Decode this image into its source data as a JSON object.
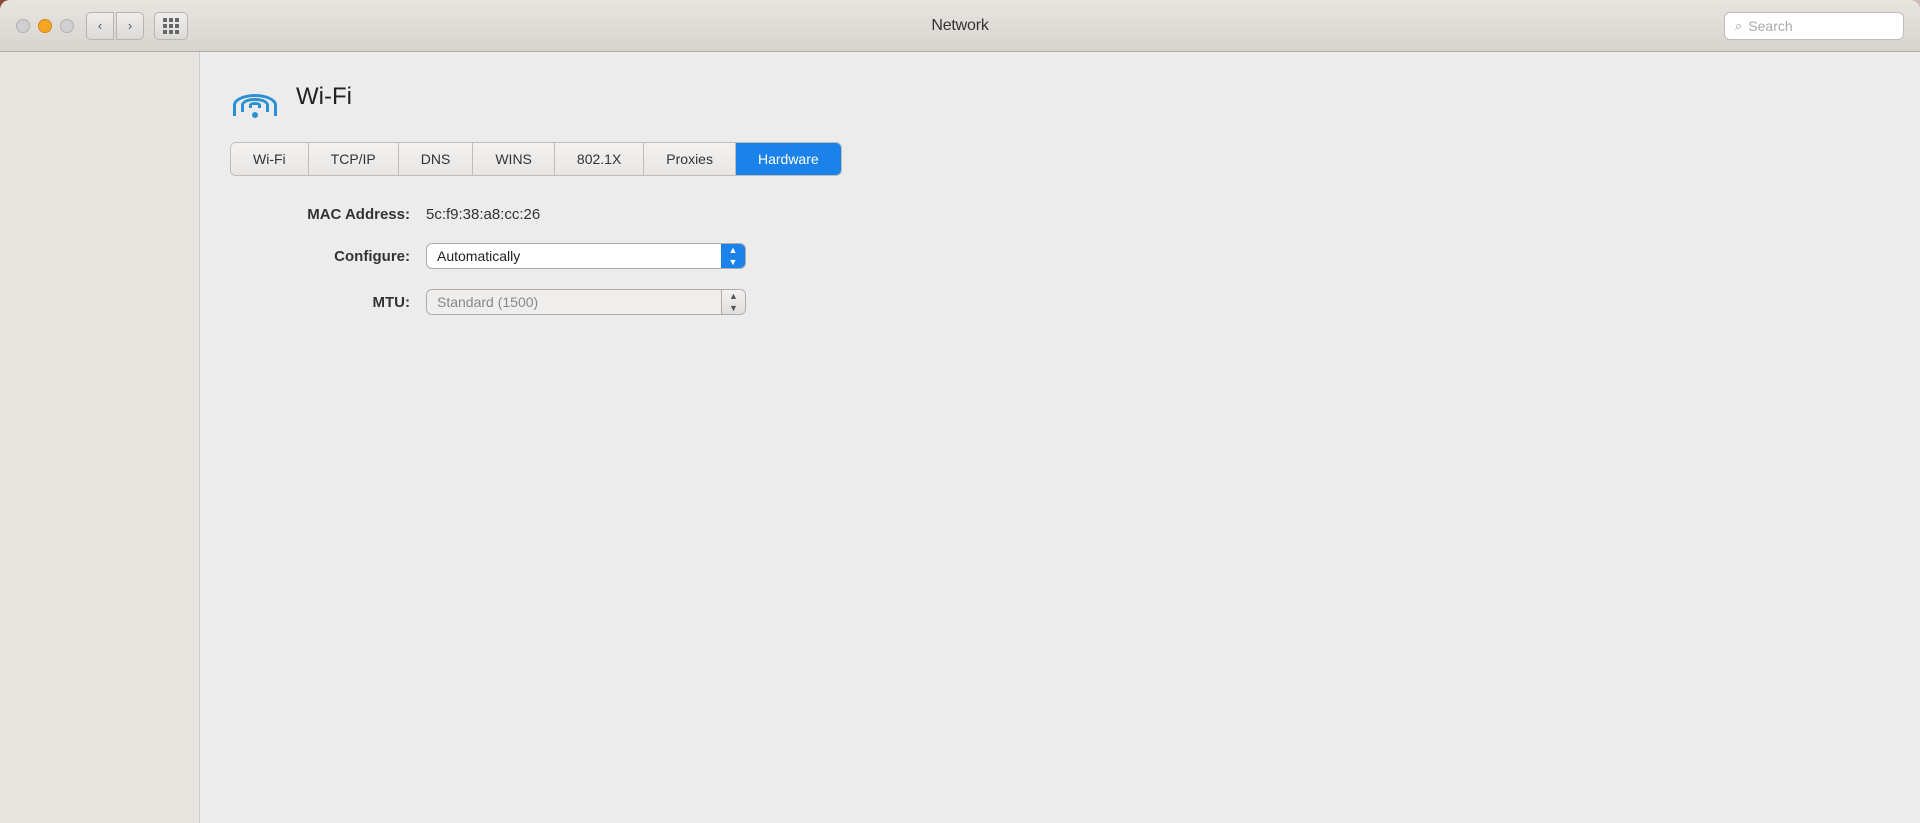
{
  "desktop": {
    "bg_note": "macOS desktop background"
  },
  "titlebar": {
    "title": "Network",
    "search_placeholder": "Search",
    "back_label": "‹",
    "forward_label": "›"
  },
  "traffic_lights": {
    "close_label": "",
    "minimize_label": "",
    "maximize_label": ""
  },
  "wifi_section": {
    "icon_label": "Wi-Fi icon",
    "label": "Wi-Fi"
  },
  "tabs": [
    {
      "id": "wifi",
      "label": "Wi-Fi",
      "active": false
    },
    {
      "id": "tcpip",
      "label": "TCP/IP",
      "active": false
    },
    {
      "id": "dns",
      "label": "DNS",
      "active": false
    },
    {
      "id": "wins",
      "label": "WINS",
      "active": false
    },
    {
      "id": "8021x",
      "label": "802.1X",
      "active": false
    },
    {
      "id": "proxies",
      "label": "Proxies",
      "active": false
    },
    {
      "id": "hardware",
      "label": "Hardware",
      "active": true
    }
  ],
  "hardware_fields": {
    "mac_label": "MAC Address:",
    "mac_value": "5c:f9:38:a8:cc:26",
    "configure_label": "Configure:",
    "configure_value": "Automatically",
    "mtu_label": "MTU:",
    "mtu_value": "Standard  (1500)"
  },
  "colors": {
    "active_tab_bg": "#1a82e8",
    "wifi_icon_color": "#2b8fd4",
    "select_arrow_bg": "#1a82e8"
  }
}
